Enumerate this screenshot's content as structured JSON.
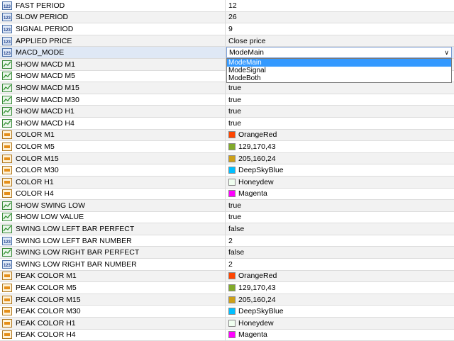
{
  "rows": [
    {
      "name": "FAST PERIOD",
      "value": "12",
      "icon": "numeric-123-icon"
    },
    {
      "name": "SLOW PERIOD",
      "value": "26",
      "icon": "numeric-123-icon"
    },
    {
      "name": "SIGNAL PERIOD",
      "value": "9",
      "icon": "numeric-123-icon"
    },
    {
      "name": "APPLIED PRICE",
      "value": "Close price",
      "icon": "numeric-123-icon"
    },
    {
      "name": "MACD_MODE",
      "value": "ModeMain",
      "icon": "numeric-123-icon"
    },
    {
      "name": "SHOW MACD M1",
      "value": "",
      "icon": "boolean-chart-icon"
    },
    {
      "name": "SHOW MACD M5",
      "value": "",
      "icon": "boolean-chart-icon"
    },
    {
      "name": "SHOW MACD M15",
      "value": "true",
      "icon": "boolean-chart-icon"
    },
    {
      "name": "SHOW MACD M30",
      "value": "true",
      "icon": "boolean-chart-icon"
    },
    {
      "name": "SHOW MACD H1",
      "value": "true",
      "icon": "boolean-chart-icon"
    },
    {
      "name": "SHOW MACD H4",
      "value": "true",
      "icon": "boolean-chart-icon"
    },
    {
      "name": "COLOR M1",
      "value": "OrangeRed",
      "icon": "color-icon",
      "color": "#ff4500"
    },
    {
      "name": "COLOR M5",
      "value": "129,170,43",
      "icon": "color-icon",
      "color": "#81aa2b"
    },
    {
      "name": "COLOR M15",
      "value": "205,160,24",
      "icon": "color-icon",
      "color": "#cda018"
    },
    {
      "name": "COLOR M30",
      "value": "DeepSkyBlue",
      "icon": "color-icon",
      "color": "#00bfff"
    },
    {
      "name": "COLOR H1",
      "value": "Honeydew",
      "icon": "color-icon",
      "color": "#f0fff0"
    },
    {
      "name": "COLOR H4",
      "value": "Magenta",
      "icon": "color-icon",
      "color": "#ff00ff"
    },
    {
      "name": "SHOW SWING LOW",
      "value": "true",
      "icon": "boolean-chart-icon"
    },
    {
      "name": "SHOW LOW VALUE",
      "value": "true",
      "icon": "boolean-chart-icon"
    },
    {
      "name": "SWING LOW LEFT BAR PERFECT",
      "value": "false",
      "icon": "boolean-chart-icon"
    },
    {
      "name": "SWING LOW LEFT BAR NUMBER",
      "value": "2",
      "icon": "numeric-123-icon"
    },
    {
      "name": "SWING LOW RIGHT BAR PERFECT",
      "value": "false",
      "icon": "boolean-chart-icon"
    },
    {
      "name": "SWING LOW RIGHT BAR NUMBER",
      "value": "2",
      "icon": "numeric-123-icon"
    },
    {
      "name": "PEAK COLOR M1",
      "value": "OrangeRed",
      "icon": "color-icon",
      "color": "#ff4500"
    },
    {
      "name": "PEAK COLOR M5",
      "value": "129,170,43",
      "icon": "color-icon",
      "color": "#81aa2b"
    },
    {
      "name": "PEAK COLOR M15",
      "value": "205,160,24",
      "icon": "color-icon",
      "color": "#cda018"
    },
    {
      "name": "PEAK COLOR M30",
      "value": "DeepSkyBlue",
      "icon": "color-icon",
      "color": "#00bfff"
    },
    {
      "name": "PEAK COLOR H1",
      "value": "Honeydew",
      "icon": "color-icon",
      "color": "#f0fff0"
    },
    {
      "name": "PEAK COLOR H4",
      "value": "Magenta",
      "icon": "color-icon",
      "color": "#ff00ff"
    }
  ],
  "dropdown": {
    "selected": "ModeMain",
    "options": [
      "ModeMain",
      "ModeSignal",
      "ModeBoth"
    ],
    "highlight_color": "#3399ff"
  }
}
